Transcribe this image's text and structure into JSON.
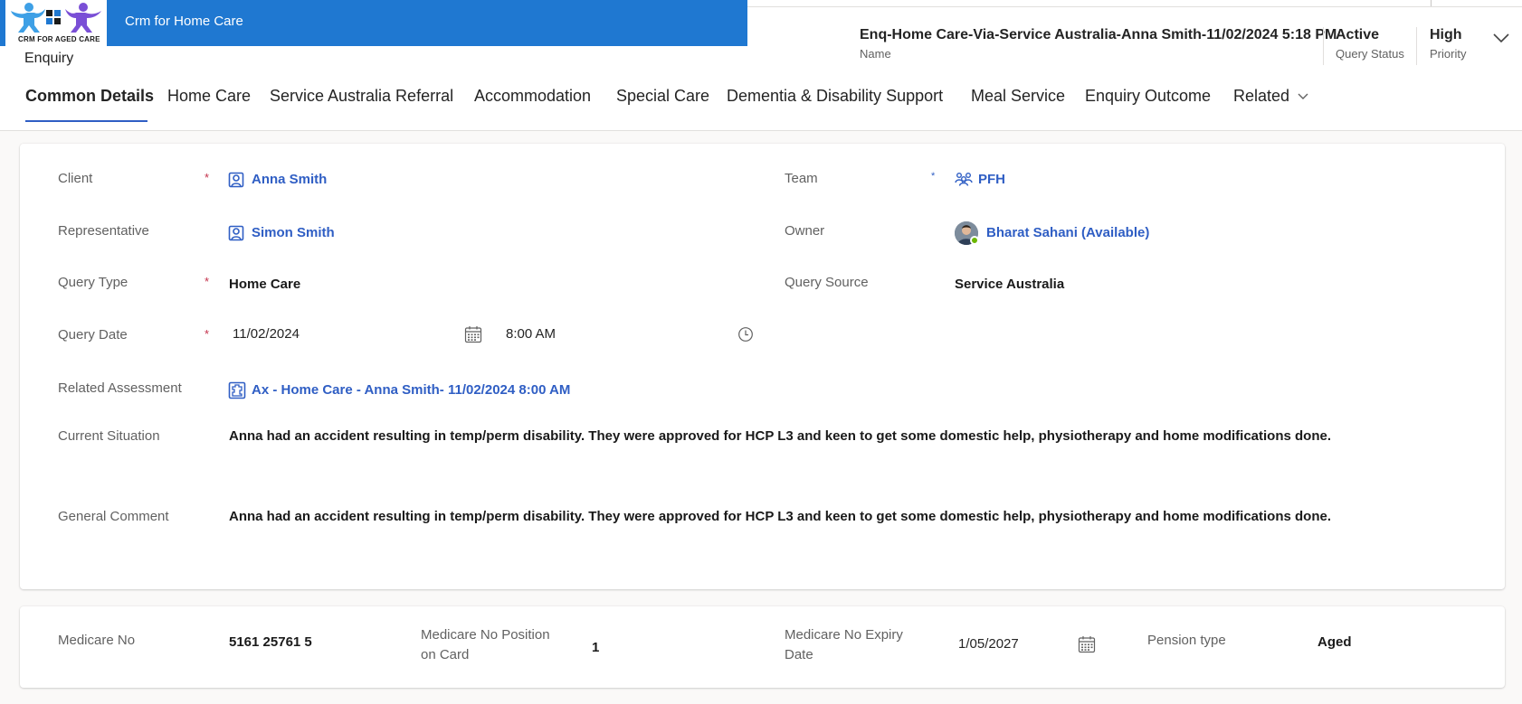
{
  "app": {
    "title": "Crm for Home Care",
    "logo_text": "CRM FOR AGED CARE",
    "colors": {
      "appbar": "#1f78d1",
      "link": "#2f5ec4",
      "required": "#c4314b",
      "presence": "#6bb700"
    }
  },
  "record": {
    "entity": "Enquiry",
    "name_value": "Enq-Home Care-Via-Service Australia-Anna Smith-11/02/2024 5:18 PM",
    "name_label": "Name",
    "status_value": "Active",
    "status_label": "Query Status",
    "priority_value": "High",
    "priority_label": "Priority",
    "expand_icon": "chevron-down-icon"
  },
  "tabs": [
    {
      "label": "Common Details",
      "active": true
    },
    {
      "label": "Home Care"
    },
    {
      "label": "Service Australia Referral"
    },
    {
      "label": "Accommodation"
    },
    {
      "label": "Special Care"
    },
    {
      "label": "Dementia & Disability Support"
    },
    {
      "label": "Meal Service"
    },
    {
      "label": "Enquiry Outcome"
    },
    {
      "label": "Related"
    }
  ],
  "form": {
    "client": {
      "label": "Client",
      "required": "*",
      "value": "Anna Smith",
      "icon": "contact-icon"
    },
    "team": {
      "label": "Team",
      "required": "*",
      "value": "PFH",
      "icon": "team-icon"
    },
    "representative": {
      "label": "Representative",
      "value": "Simon Smith",
      "icon": "contact-icon"
    },
    "owner": {
      "label": "Owner",
      "value": "Bharat Sahani (Available)",
      "icon": "avatar"
    },
    "query_type": {
      "label": "Query Type",
      "required": "*",
      "value": "Home Care"
    },
    "query_source": {
      "label": "Query Source",
      "value": "Service Australia"
    },
    "query_date": {
      "label": "Query Date",
      "required": "*",
      "date": "11/02/2024",
      "time": "8:00 AM"
    },
    "related_assessment": {
      "label": "Related Assessment",
      "value": "Ax - Home Care - Anna Smith- 11/02/2024 8:00 AM",
      "icon": "assessment-icon"
    },
    "current_situation": {
      "label": "Current Situation",
      "value": "Anna had an accident resulting in temp/perm disability. They were approved for HCP L3 and keen to get some domestic help, physiotherapy and home modifications done."
    },
    "general_comment": {
      "label": "General Comment",
      "value": "Anna had an accident resulting in temp/perm disability. They were approved for HCP L3 and keen to get some domestic help, physiotherapy and home modifications done."
    }
  },
  "medicare": {
    "number": {
      "label": "Medicare No",
      "value": "5161 25761 5"
    },
    "position": {
      "label_line1": "Medicare No Position",
      "label_line2": "on Card",
      "value": "1"
    },
    "expiry": {
      "label_line1": "Medicare No Expiry",
      "label_line2": "Date",
      "value": "1/05/2027"
    },
    "pension": {
      "label": "Pension type",
      "value": "Aged"
    }
  }
}
